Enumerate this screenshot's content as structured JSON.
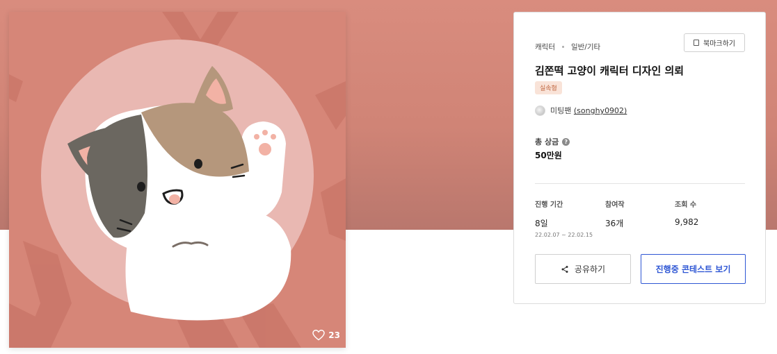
{
  "artwork": {
    "like_count": "23",
    "colors": {
      "background": "#d68678",
      "circle": "#e9b8b2",
      "body": "#ffffff",
      "brown_patch": "#b5977c",
      "gray_patch": "#6b6760",
      "ear_inner": "#f2b2a5"
    }
  },
  "breadcrumb": {
    "category": "캐릭터",
    "subcategory": "일반/기타"
  },
  "bookmark": {
    "label": "북마크하기"
  },
  "contest": {
    "title": "김쫀떡 고양이 캐릭터 디자인 의뢰",
    "type_badge": "실속형"
  },
  "host": {
    "name": "미팅팬",
    "handle": "(songhy0902)"
  },
  "prize": {
    "label": "총 상금",
    "value": "50만원",
    "help_icon": "question-circle-icon"
  },
  "stats": {
    "period": {
      "label": "진행 기간",
      "value": "8일",
      "range": "22.02.07 ~ 22.02.15"
    },
    "entries": {
      "label": "참여작",
      "value": "36개"
    },
    "views": {
      "label": "조회 수",
      "value": "9,982"
    }
  },
  "actions": {
    "share_label": "공유하기",
    "contests_label": "진행중 콘테스트 보기"
  },
  "theme": {
    "banner": "#d08476",
    "accent_blue": "#2e56d4",
    "badge_bg": "#f9e3d8",
    "badge_text": "#c0653e"
  }
}
